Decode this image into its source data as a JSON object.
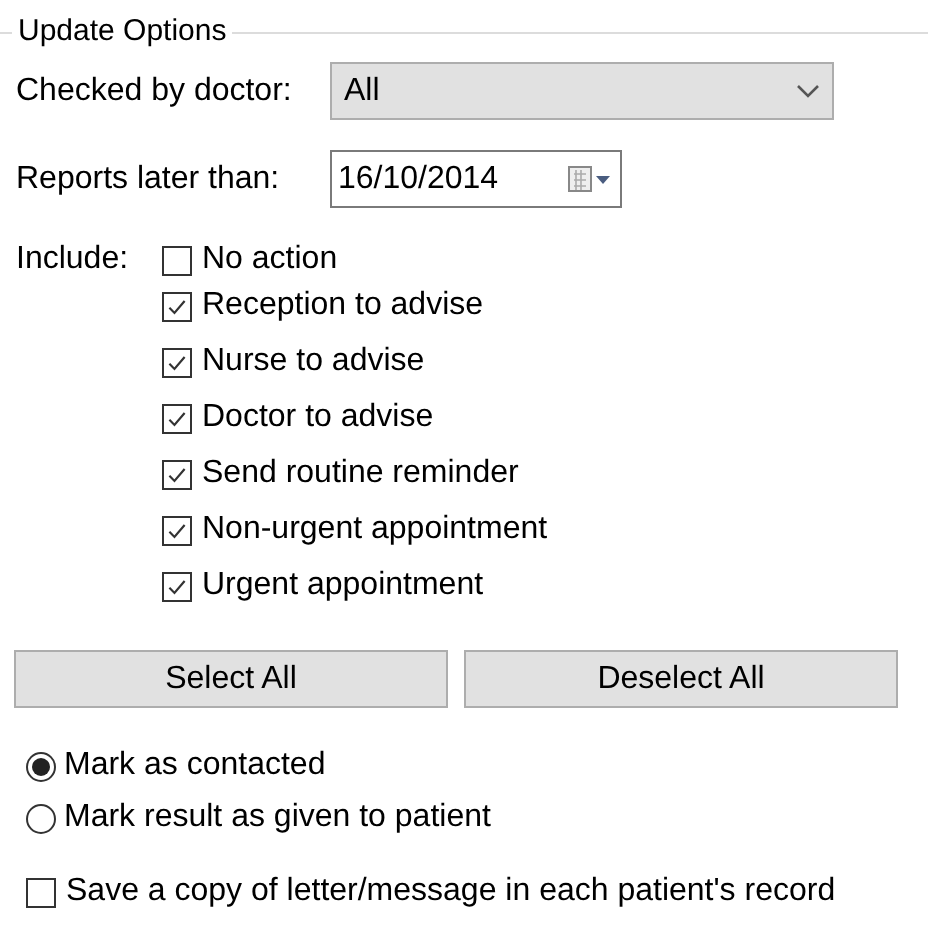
{
  "group": {
    "title": "Update Options"
  },
  "checked_by_doctor": {
    "label": "Checked by doctor:",
    "value": "All"
  },
  "reports_later_than": {
    "label": "Reports later than:",
    "value": "16/10/2014"
  },
  "include": {
    "label": "Include:",
    "options": [
      {
        "label": "No action",
        "checked": false
      },
      {
        "label": "Reception to advise",
        "checked": true
      },
      {
        "label": "Nurse to advise",
        "checked": true
      },
      {
        "label": "Doctor to advise",
        "checked": true
      },
      {
        "label": "Send routine reminder",
        "checked": true
      },
      {
        "label": "Non-urgent appointment",
        "checked": true
      },
      {
        "label": "Urgent appointment",
        "checked": true
      }
    ]
  },
  "buttons": [
    "Select All",
    "Deselect All"
  ],
  "mark_options": [
    {
      "label": "Mark as contacted",
      "selected": true
    },
    {
      "label": "Mark result as given to patient",
      "selected": false
    }
  ],
  "save_copy": {
    "label": "Save a copy of letter/message in each patient's record",
    "checked": false
  }
}
